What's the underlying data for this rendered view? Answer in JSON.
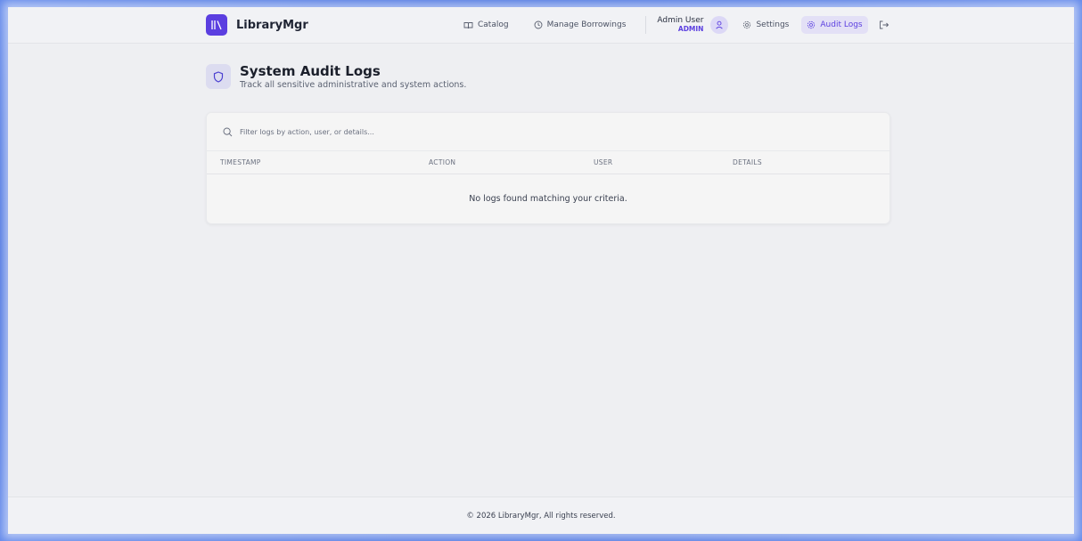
{
  "brand": {
    "name": "LibraryMgr",
    "logo_icon": "library-books-icon",
    "color": "#5b3fe0"
  },
  "nav": {
    "catalog": {
      "label": "Catalog",
      "icon": "book-open-icon"
    },
    "borrowings": {
      "label": "Manage Borrowings",
      "icon": "clock-icon"
    },
    "user": {
      "name": "Admin User",
      "role": "ADMIN",
      "icon": "user-icon"
    },
    "settings": {
      "label": "Settings",
      "icon": "gear-icon"
    },
    "audit_logs": {
      "label": "Audit Logs",
      "icon": "gear-icon",
      "active": true
    },
    "logout": {
      "icon": "logout-icon"
    }
  },
  "page": {
    "title": "System Audit Logs",
    "subtitle": "Track all sensitive administrative and system actions.",
    "icon": "shield-icon"
  },
  "filter": {
    "placeholder": "Filter logs by action, user, or details...",
    "value": "",
    "icon": "search-icon"
  },
  "table": {
    "columns": [
      "TIMESTAMP",
      "ACTION",
      "USER",
      "DETAILS"
    ],
    "rows": [],
    "empty_message": "No logs found matching your criteria."
  },
  "footer": {
    "text": "© 2026 LibraryMgr, All rights reserved."
  },
  "colors": {
    "accent": "#5b3fe0",
    "active_bg": "#e3e0f6",
    "background": "#eeeff2"
  }
}
